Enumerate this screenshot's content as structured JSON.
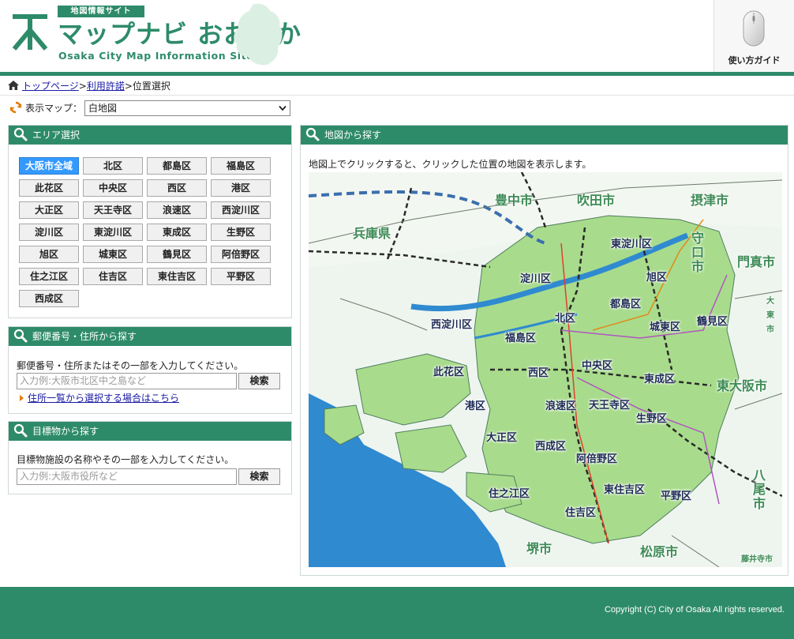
{
  "header": {
    "badge": "地図情報サイト",
    "title": "マップナビ おおさか",
    "subtitle": "Osaka City Map Information Site",
    "guide_label": "使い方ガイド"
  },
  "breadcrumb": {
    "items": [
      {
        "label": "トップページ",
        "link": true
      },
      {
        "label": "利用許諾",
        "link": true
      },
      {
        "label": "位置選択",
        "link": false
      }
    ],
    "separator": ">"
  },
  "map_select": {
    "label": "表示マップ：",
    "value": "白地図"
  },
  "area_panel": {
    "title": "エリア選択",
    "buttons": [
      "大阪市全域",
      "北区",
      "都島区",
      "福島区",
      "此花区",
      "中央区",
      "西区",
      "港区",
      "大正区",
      "天王寺区",
      "浪速区",
      "西淀川区",
      "淀川区",
      "東淀川区",
      "東成区",
      "生野区",
      "旭区",
      "城東区",
      "鶴見区",
      "阿倍野区",
      "住之江区",
      "住吉区",
      "東住吉区",
      "平野区",
      "西成区"
    ],
    "active_index": 0
  },
  "address_panel": {
    "title": "郵便番号・住所から探す",
    "hint": "郵便番号・住所またはその一部を入力してください。",
    "placeholder": "入力例:大阪市北区中之島など",
    "search_label": "検索",
    "link_label": "住所一覧から選択する場合はこちら"
  },
  "landmark_panel": {
    "title": "目標物から探す",
    "hint": "目標物施設の名称やその一部を入力してください。",
    "placeholder": "入力例:大阪市役所など",
    "search_label": "検索"
  },
  "map_panel": {
    "title": "地図から探す",
    "description": "地図上でクリックすると、クリックした位置の地図を表示します。",
    "ward_labels": [
      "東淀川区",
      "淀川区",
      "旭区",
      "都島区",
      "西淀川区",
      "北区",
      "福島区",
      "城東区",
      "鶴見区",
      "此花区",
      "西区",
      "中央区",
      "東成区",
      "港区",
      "浪速区",
      "天王寺区",
      "生野区",
      "大正区",
      "西成区",
      "阿倍野区",
      "東住吉区",
      "平野区",
      "住之江区",
      "住吉区"
    ],
    "city_labels": [
      "豊中市",
      "吹田市",
      "摂津市",
      "兵庫県",
      "守口市",
      "門真市",
      "大東市",
      "東大阪市",
      "八尾市",
      "堺市",
      "松原市",
      "藤井寺市"
    ]
  },
  "footer": {
    "copyright": "Copyright (C) City of Osaka All rights reserved."
  },
  "colors": {
    "brand": "#2e8b6a",
    "active_button": "#3399ff",
    "link": "#1a1aa6",
    "sea": "#2f8ad0",
    "osaka_land": "#a8dc8c"
  }
}
